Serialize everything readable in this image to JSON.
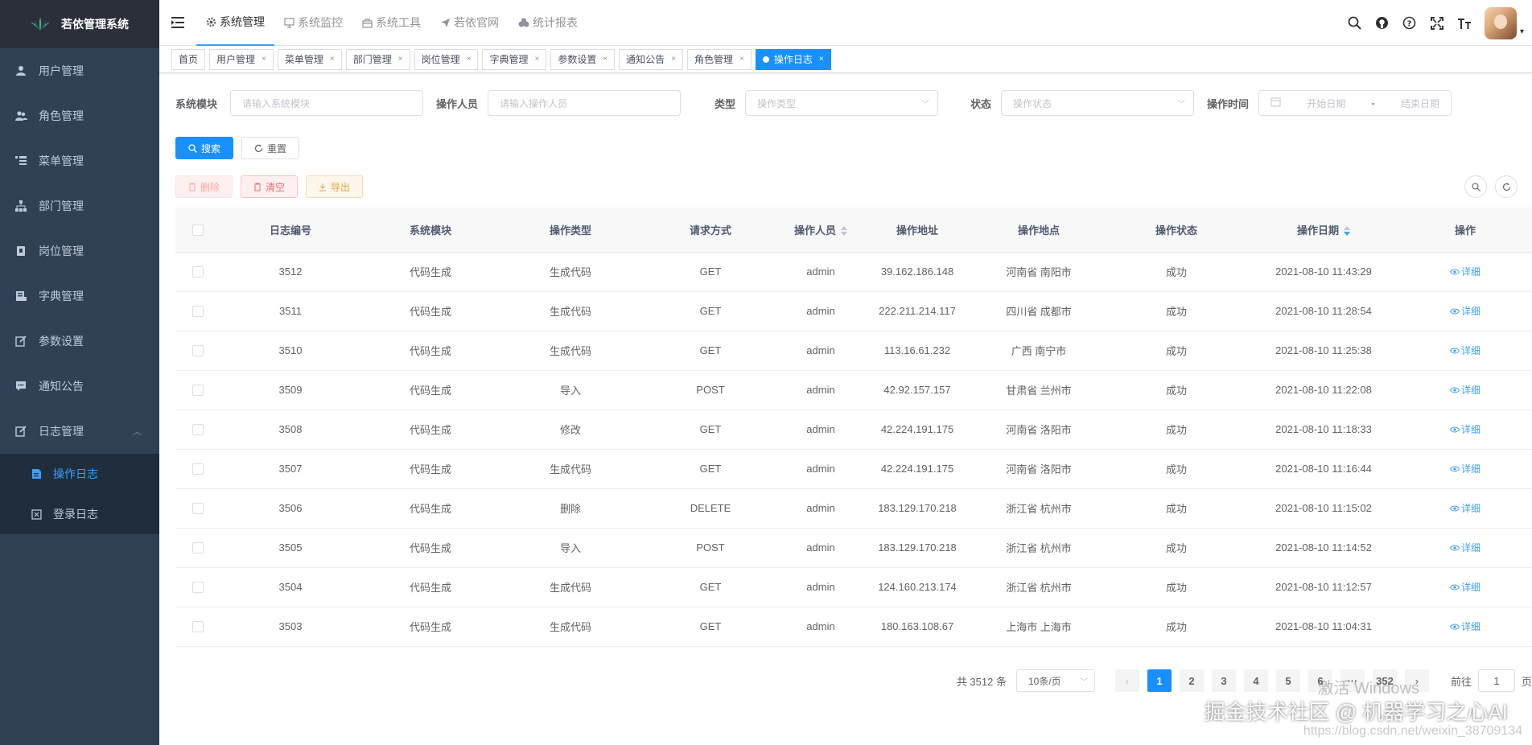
{
  "app": {
    "title": "若依管理系统"
  },
  "sidebar": {
    "items": [
      {
        "label": "用户管理",
        "icon": "user-icon"
      },
      {
        "label": "角色管理",
        "icon": "peoples-icon"
      },
      {
        "label": "菜单管理",
        "icon": "tree-table-icon"
      },
      {
        "label": "部门管理",
        "icon": "tree-icon"
      },
      {
        "label": "岗位管理",
        "icon": "post-icon"
      },
      {
        "label": "字典管理",
        "icon": "dict-icon"
      },
      {
        "label": "参数设置",
        "icon": "edit-icon"
      },
      {
        "label": "通知公告",
        "icon": "message-icon"
      },
      {
        "label": "日志管理",
        "icon": "log-icon",
        "expanded": true
      }
    ],
    "subitems": [
      {
        "label": "操作日志",
        "icon": "form-icon",
        "active": true
      },
      {
        "label": "登录日志",
        "icon": "logininfor-icon"
      }
    ]
  },
  "topnav": [
    {
      "label": "系统管理",
      "icon": "gear-icon",
      "active": true
    },
    {
      "label": "系统监控",
      "icon": "monitor-icon"
    },
    {
      "label": "系统工具",
      "icon": "tool-icon"
    },
    {
      "label": "若依官网",
      "icon": "send-icon"
    },
    {
      "label": "统计报表",
      "icon": "chart-icon"
    }
  ],
  "tags": [
    {
      "label": "首页",
      "closable": false
    },
    {
      "label": "用户管理",
      "closable": true
    },
    {
      "label": "菜单管理",
      "closable": true
    },
    {
      "label": "部门管理",
      "closable": true
    },
    {
      "label": "岗位管理",
      "closable": true
    },
    {
      "label": "字典管理",
      "closable": true
    },
    {
      "label": "参数设置",
      "closable": true
    },
    {
      "label": "通知公告",
      "closable": true
    },
    {
      "label": "角色管理",
      "closable": true
    },
    {
      "label": "操作日志",
      "closable": true,
      "active": true
    }
  ],
  "tag_close": "×",
  "search": {
    "module_label": "系统模块",
    "module_placeholder": "请输入系统模块",
    "operator_label": "操作人员",
    "operator_placeholder": "请输入操作人员",
    "type_label": "类型",
    "type_placeholder": "操作类型",
    "status_label": "状态",
    "status_placeholder": "操作状态",
    "time_label": "操作时间",
    "start_placeholder": "开始日期",
    "range_sep": "-",
    "end_placeholder": "结束日期",
    "search_button": "搜索",
    "reset_button": "重置"
  },
  "toolbar": {
    "delete_label": "删除",
    "clear_label": "清空",
    "export_label": "导出"
  },
  "table": {
    "columns": [
      "日志编号",
      "系统模块",
      "操作类型",
      "请求方式",
      "操作人员",
      "操作地址",
      "操作地点",
      "操作状态",
      "操作日期",
      "操作"
    ],
    "detail_label": "详细",
    "rows": [
      [
        "3512",
        "代码生成",
        "生成代码",
        "GET",
        "admin",
        "39.162.186.148",
        "河南省 南阳市",
        "成功",
        "2021-08-10 11:43:29"
      ],
      [
        "3511",
        "代码生成",
        "生成代码",
        "GET",
        "admin",
        "222.211.214.117",
        "四川省 成都市",
        "成功",
        "2021-08-10 11:28:54"
      ],
      [
        "3510",
        "代码生成",
        "生成代码",
        "GET",
        "admin",
        "113.16.61.232",
        "广西 南宁市",
        "成功",
        "2021-08-10 11:25:38"
      ],
      [
        "3509",
        "代码生成",
        "导入",
        "POST",
        "admin",
        "42.92.157.157",
        "甘肃省 兰州市",
        "成功",
        "2021-08-10 11:22:08"
      ],
      [
        "3508",
        "代码生成",
        "修改",
        "GET",
        "admin",
        "42.224.191.175",
        "河南省 洛阳市",
        "成功",
        "2021-08-10 11:18:33"
      ],
      [
        "3507",
        "代码生成",
        "生成代码",
        "GET",
        "admin",
        "42.224.191.175",
        "河南省 洛阳市",
        "成功",
        "2021-08-10 11:16:44"
      ],
      [
        "3506",
        "代码生成",
        "删除",
        "DELETE",
        "admin",
        "183.129.170.218",
        "浙江省 杭州市",
        "成功",
        "2021-08-10 11:15:02"
      ],
      [
        "3505",
        "代码生成",
        "导入",
        "POST",
        "admin",
        "183.129.170.218",
        "浙江省 杭州市",
        "成功",
        "2021-08-10 11:14:52"
      ],
      [
        "3504",
        "代码生成",
        "生成代码",
        "GET",
        "admin",
        "124.160.213.174",
        "浙江省 杭州市",
        "成功",
        "2021-08-10 11:12:57"
      ],
      [
        "3503",
        "代码生成",
        "生成代码",
        "GET",
        "admin",
        "180.163.108.67",
        "上海市 上海市",
        "成功",
        "2021-08-10 11:04:31"
      ]
    ]
  },
  "pagination": {
    "total": "共 3512 条",
    "page_size": "10条/页",
    "pages": [
      "1",
      "2",
      "3",
      "4",
      "5",
      "6",
      "···",
      "352"
    ],
    "current": "1",
    "goto_label": "前往",
    "goto_value": "1",
    "page_suffix": "页"
  },
  "watermarks": {
    "activate": "激活 Windows",
    "community": "掘金技术社区 @ 机器学习之心AI",
    "url": "https://blog.csdn.net/weixin_38709134"
  }
}
